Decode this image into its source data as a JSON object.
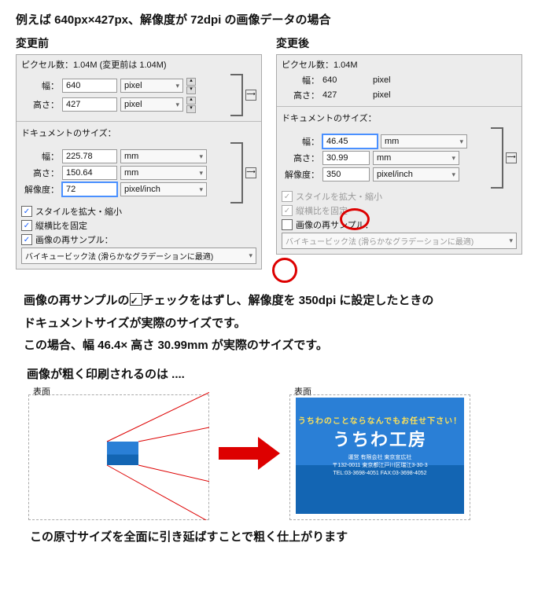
{
  "intro": "例えば 640px×427px、解像度が 72dpi の画像データの場合",
  "before": {
    "heading": "変更前",
    "pixel_line": "ピクセル数：1.04M (変更前は 1.04M)",
    "width_label": "幅：",
    "width_value": "640",
    "height_label": "高さ：",
    "height_value": "427",
    "unit_pixel": "pixel",
    "doc_title": "ドキュメントのサイズ：",
    "doc_width": "225.78",
    "doc_height": "150.64",
    "doc_unit": "mm",
    "res_label": "解像度：",
    "res_value": "72",
    "res_unit": "pixel/inch",
    "cb1": "スタイルを拡大・縮小",
    "cb2": "縦横比を固定",
    "cb3": "画像の再サンプル：",
    "method": "バイキュービック法 (滑らかなグラデーションに最適)"
  },
  "after": {
    "heading": "変更後",
    "pixel_line": "ピクセル数：1.04M",
    "width_label": "幅：",
    "width_value": "640",
    "height_label": "高さ：",
    "height_value": "427",
    "unit_pixel": "pixel",
    "doc_title": "ドキュメントのサイズ：",
    "doc_width": "46.45",
    "doc_height": "30.99",
    "doc_unit": "mm",
    "res_label": "解像度：",
    "res_value": "350",
    "res_unit": "pixel/inch",
    "cb1": "スタイルを拡大・縮小",
    "cb2": "縦横比を固定",
    "cb3": "画像の再サンプル：",
    "method": "バイキュービック法 (滑らかなグラデーションに最適)"
  },
  "explain": {
    "line1a": "画像の再サンプルの",
    "line1b": "チェックをはずし、解像度を 350dpi に設定したときの",
    "line2": "ドキュメントサイズが実際のサイズです。",
    "line3": "この場合、幅 46.4× 高さ 30.99mm が実際のサイズです。"
  },
  "section2": {
    "heading": "画像が粗く印刷されるのは ....",
    "face_label": "表面",
    "arc_text": "うちわのことならなんでもお任せ下さい！",
    "big_title": "うちわ工房",
    "sub1": "運営 有限会社 東京宣広社",
    "sub2": "〒132-0011 東京都江戸川区瑞江3-30-3",
    "sub3": "TEL:03-3698-4051  FAX:03-3698-4052",
    "conclusion": "この原寸サイズを全面に引き延ばすことで粗く仕上がります"
  }
}
